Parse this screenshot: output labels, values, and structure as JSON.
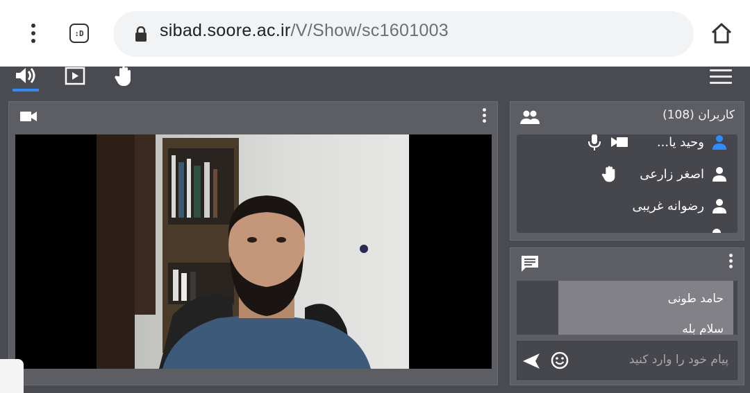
{
  "browser": {
    "tab_icon_label": ":D",
    "url_host": "sibad.soore.ac.ir",
    "url_path": "/V/Show/sc1601003",
    "icons": [
      "more-vert-icon",
      "tab-switcher-icon",
      "lock-icon",
      "home-icon"
    ]
  },
  "toolbar": {
    "icons": [
      "volume-icon",
      "screen-share-icon",
      "raise-hand-icon",
      "menu-icon"
    ],
    "active_accent": "#2d8cff"
  },
  "video": {
    "icons": [
      "videocam-icon",
      "more-vert-icon"
    ]
  },
  "users": {
    "title": "کاربران (108)",
    "list": [
      {
        "name": "وحید یا...",
        "icons": [
          "person-icon",
          "videocam-icon",
          "mic-icon"
        ],
        "highlight": "#2d8cff"
      },
      {
        "name": "اصغر زارعی",
        "icons": [
          "person-icon",
          "raise-hand-icon"
        ]
      },
      {
        "name": "رضوانه غریبی",
        "icons": [
          "person-icon"
        ]
      }
    ]
  },
  "chat": {
    "messages": [
      {
        "author": "حامد طونی",
        "text": "سلام بله"
      }
    ],
    "input_placeholder": "پیام خود را وارد کنید",
    "icons": [
      "chat-icon",
      "emoji-icon",
      "send-icon",
      "more-vert-icon"
    ]
  }
}
